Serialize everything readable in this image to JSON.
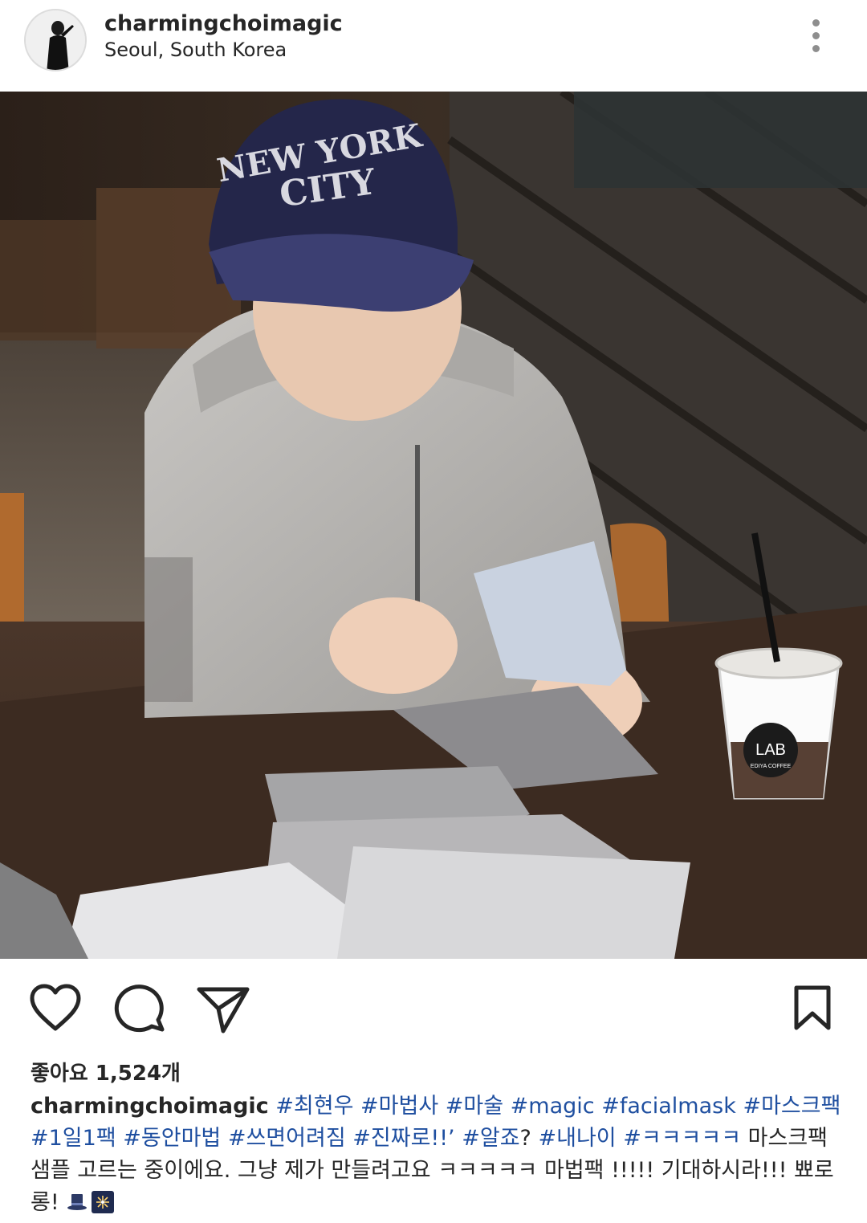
{
  "header": {
    "username": "charmingchoimagic",
    "location": "Seoul, South Korea",
    "more_icon": "more-vertical-icon"
  },
  "photo": {
    "cap_text_line1": "NEW YORK",
    "cap_text_line2": "CITY",
    "cup_logo": "LAB",
    "cup_sub": "EDIYA COFFEE"
  },
  "actions": {
    "like_icon": "heart-icon",
    "comment_icon": "comment-icon",
    "share_icon": "send-icon",
    "save_icon": "bookmark-icon"
  },
  "likes_text": "좋아요 1,524개",
  "caption": {
    "author": "charmingchoimagic",
    "segments": [
      {
        "type": "tag",
        "text": "#최현우"
      },
      {
        "type": "tag",
        "text": "#마법사"
      },
      {
        "type": "tag",
        "text": "#마술"
      },
      {
        "type": "tag",
        "text": "#magic"
      },
      {
        "type": "tag",
        "text": "#facialmask"
      },
      {
        "type": "tag",
        "text": "#마스크팩"
      },
      {
        "type": "tag",
        "text": "#1일1팩"
      },
      {
        "type": "tag",
        "text": "#동안마법"
      },
      {
        "type": "tag",
        "text": "#쓰면어려짐"
      },
      {
        "type": "tag",
        "text": "#진짜로!!’"
      },
      {
        "type": "tag",
        "text": "#알죠"
      },
      {
        "type": "text",
        "text": "?"
      },
      {
        "type": "tag",
        "text": "#내나이"
      },
      {
        "type": "tag",
        "text": "#ㅋㅋㅋㅋㅋ"
      },
      {
        "type": "text",
        "text": "마스크팩 샘플 고르는 중이에요.  그냥 제가 만들려고요 ㅋㅋㅋㅋㅋ 마법팩 !!!!! 기대하시라!!! 뾰로롱!"
      }
    ],
    "emojis": [
      "top-hat-icon",
      "fireworks-night-icon"
    ]
  }
}
